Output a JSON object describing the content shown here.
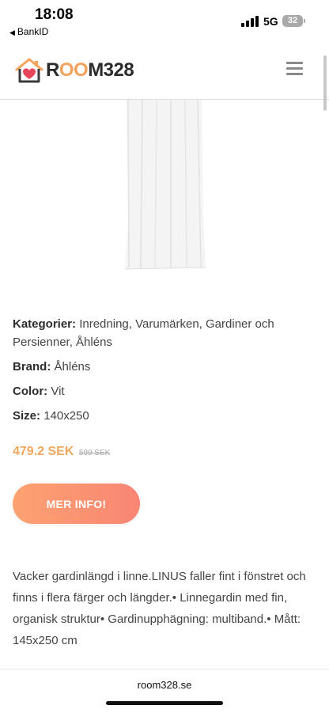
{
  "status_bar": {
    "time": "18:08",
    "back_app": "BankID",
    "network": "5G",
    "battery": "32"
  },
  "header": {
    "logo_text_1": "R",
    "logo_text_oo": "OO",
    "logo_text_2": "M328"
  },
  "product": {
    "category_label": "Kategorier:",
    "category_value": "Inredning, Varumärken, Gardiner och Persienner, Åhléns",
    "brand_label": "Brand:",
    "brand_value": "Åhléns",
    "color_label": "Color:",
    "color_value": "Vit",
    "size_label": "Size:",
    "size_value": "140x250",
    "price": "479.2 SEK",
    "old_price": "599 SEK",
    "cta_label": "MER INFO!",
    "description": "Vacker gardinlängd i linne.LINUS faller fint i fönstret och finns i flera färger och längder.• Linnegardin med fin, organisk struktur• Gardinupphägning: multiband.• Mått: 145x250 cm"
  },
  "browser": {
    "url": "room328.se"
  },
  "colors": {
    "accent_price": "#f0a75e",
    "button_gradient_start": "#fda271",
    "button_gradient_end": "#f88573"
  }
}
